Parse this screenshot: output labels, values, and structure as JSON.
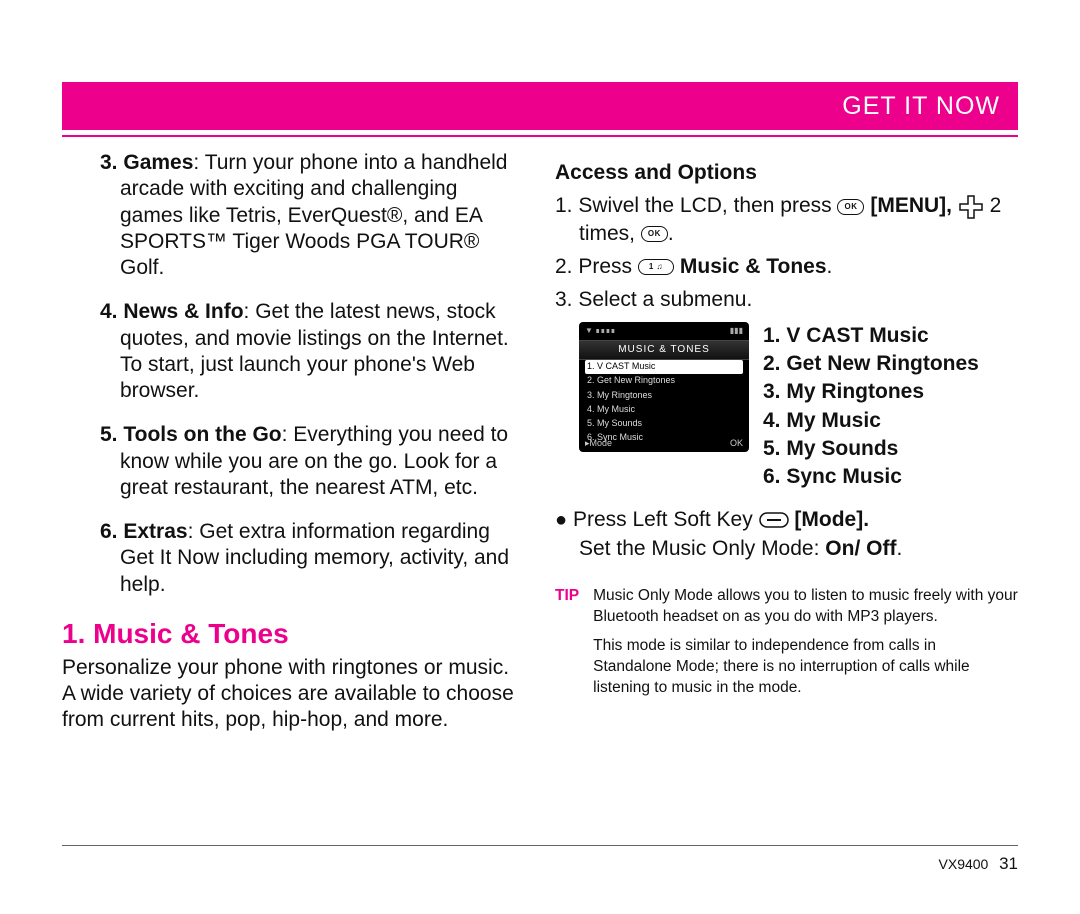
{
  "header": {
    "title": "GET IT NOW"
  },
  "colors": {
    "accent": "#ec008c"
  },
  "left": {
    "features": [
      {
        "num": "3.",
        "name": "Games",
        "desc": ": Turn your phone into a handheld arcade with exciting and challenging games like Tetris, EverQuest®, and EA SPORTS™ Tiger Woods PGA TOUR® Golf."
      },
      {
        "num": "4.",
        "name": "News & Info",
        "desc": ": Get the latest news, stock quotes, and movie listings on the Internet. To start, just launch your phone's Web browser."
      },
      {
        "num": "5.",
        "name": "Tools on the Go",
        "desc": ": Everything you need to know while you are on the go. Look for a great restaurant, the nearest ATM, etc."
      },
      {
        "num": "6.",
        "name": "Extras",
        "desc": ": Get extra information regarding Get It Now including memory, activity, and help."
      }
    ],
    "section_heading": "1. Music & Tones",
    "section_intro": "Personalize your phone with ringtones or music. A wide variety of choices are available to choose from current hits, pop, hip-hop, and more."
  },
  "right": {
    "subheading": "Access and Options",
    "steps": {
      "s1": {
        "num": "1.",
        "a": "Swivel the LCD, then press ",
        "ok": "OK",
        "menu": " [MENU], ",
        "b": " 2 times, ",
        "ok2": "OK",
        "c": "."
      },
      "s2": {
        "num": "2.",
        "a": "Press ",
        "key": "1 ♫",
        "b": " Music & Tones",
        "c": "."
      },
      "s3": {
        "num": "3.",
        "a": "Select a submenu."
      }
    },
    "phone": {
      "status_left": "▼ ∎∎∎∎",
      "status_right": "▮▮▮",
      "banner": "MUSIC & TONES",
      "items": [
        "1. V CAST Music",
        "2. Get New Ringtones",
        "3. My Ringtones",
        "4. My Music",
        "5. My Sounds",
        "6. Sync Music"
      ],
      "soft_left": "▸Mode",
      "soft_right": "OK"
    },
    "submenu_labels": "1. V CAST Music\n2. Get New Ringtones\n3. My Ringtones\n4. My Music\n5. My Sounds\n6. Sync Music",
    "bullets": {
      "b1a": "Press Left Soft Key ",
      "b1_bracket": " [Mode].",
      "b2": "Set the Music Only Mode: ",
      "b2_bold": "On/ Off",
      "b2_end": "."
    },
    "tip": {
      "label": "TIP",
      "p1": "Music Only Mode allows you to listen to music freely with your Bluetooth headset on as you do with MP3 players.",
      "p2": "This mode is similar to independence from calls in Standalone Mode; there is no interruption of calls while listening to music in the mode."
    }
  },
  "footer": {
    "model": "VX9400",
    "page": "31"
  }
}
